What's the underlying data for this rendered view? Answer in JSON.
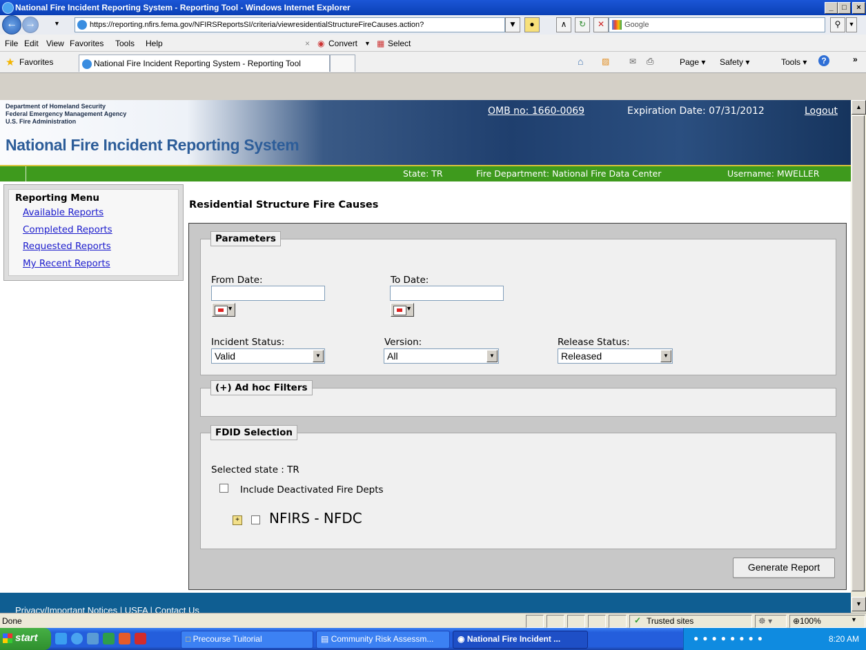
{
  "window": {
    "title": "National Fire Incident Reporting System - Reporting Tool - Windows Internet Explorer",
    "min": "_",
    "max": "□",
    "close": "×"
  },
  "address": {
    "url": "https://reporting.nfirs.fema.gov/NFIRSReportsSI/criteria/viewresidentialStructureFireCauses.action?",
    "search_placeholder": "Google"
  },
  "menubar": {
    "items": [
      "File",
      "Edit",
      "View",
      "Favorites",
      "Tools",
      "Help"
    ],
    "convert": "Convert",
    "select": "Select"
  },
  "favbar": {
    "favorites": "Favorites",
    "tab_title": "National Fire Incident Reporting System - Reporting Tool",
    "page": "Page ▾",
    "safety": "Safety ▾",
    "tools": "Tools ▾"
  },
  "banner": {
    "dept1": "Department of Homeland Security",
    "dept2": "Federal Emergency Management Agency",
    "dept3": "U.S. Fire Administration",
    "system_name": "National Fire Incident Reporting System",
    "omb": "OMB no: 1660-0069",
    "expiration": "Expiration Date: 07/31/2012",
    "logout": "Logout"
  },
  "greenbar": {
    "state": "State: TR",
    "fire_department": "Fire Department: National Fire Data Center",
    "username": "Username: MWELLER"
  },
  "reporting_menu": {
    "header": "Reporting Menu",
    "items": [
      "Available Reports",
      "Completed Reports",
      "Requested Reports",
      "My Recent Reports"
    ]
  },
  "main": {
    "title": "Residential Structure Fire Causes",
    "parameters": {
      "legend": "Parameters",
      "from_date_label": "From Date:",
      "from_date_value": "",
      "to_date_label": "To Date:",
      "to_date_value": "",
      "incident_status_label": "Incident Status:",
      "incident_status_value": "Valid",
      "version_label": "Version:",
      "version_value": "All",
      "release_status_label": "Release Status:",
      "release_status_value": "Released"
    },
    "adhoc": {
      "legend": "(+) Ad hoc Filters"
    },
    "fdid": {
      "legend": "FDID Selection",
      "selected_state": "Selected state : TR",
      "include_deactivated": "Include Deactivated Fire Depts",
      "tree_node": "NFIRS - NFDC",
      "expander": "+"
    },
    "generate_button": "Generate Report"
  },
  "footer": {
    "text": "Privacy/Important Notices | USFA | Contact Us"
  },
  "statusbar": {
    "status": "Done",
    "zone": "Trusted sites",
    "zoom": "⊕100%"
  },
  "taskbar": {
    "start": "start",
    "tasks": [
      "Precourse Tuitorial",
      "Community Risk Assessm...",
      "National Fire Incident ..."
    ],
    "clock": "8:20 AM"
  }
}
